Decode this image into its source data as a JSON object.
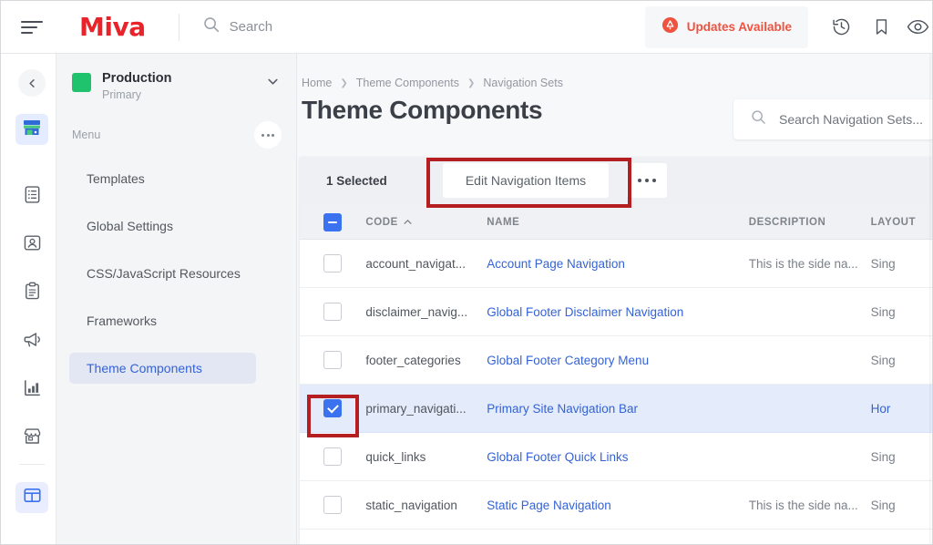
{
  "topbar": {
    "menu_icon": "hamburger-icon",
    "brand": "Miva",
    "search_placeholder": "Search",
    "search_icon": "search-icon",
    "updates_label": "Updates Available",
    "updates_icon": "alert-circle-icon",
    "updates_color": "#ef5340",
    "icons": [
      {
        "name": "history-icon"
      },
      {
        "name": "bookmark-icon"
      },
      {
        "name": "eye-icon"
      }
    ]
  },
  "rail": {
    "collapse_icon": "chevron-left-icon",
    "items": [
      {
        "name": "store-icon",
        "active": true
      },
      {
        "name": "orders-icon",
        "active": false
      },
      {
        "name": "customers-icon",
        "active": false
      },
      {
        "name": "catalog-icon",
        "active": false
      },
      {
        "name": "marketing-icon",
        "active": false
      },
      {
        "name": "reports-icon",
        "active": false
      },
      {
        "name": "storefront-icon",
        "active": false
      },
      {
        "name": "theme-icon",
        "active": true
      }
    ]
  },
  "sidebar": {
    "store_name": "Production",
    "store_sub": "Primary",
    "store_swatch_color": "#1fc26d",
    "chevron_icon": "chevron-down-icon",
    "menu_label": "Menu",
    "menu_more_icon": "ellipsis-icon",
    "items": [
      {
        "label": "Templates",
        "selected": false
      },
      {
        "label": "Global Settings",
        "selected": false
      },
      {
        "label": "CSS/JavaScript Resources",
        "selected": false
      },
      {
        "label": "Frameworks",
        "selected": false
      },
      {
        "label": "Theme Components",
        "selected": true
      }
    ]
  },
  "main": {
    "breadcrumb": [
      "Home",
      "Theme Components",
      "Navigation Sets"
    ],
    "breadcrumb_separator": "❯",
    "page_title": "Theme Components",
    "search": {
      "placeholder": "Search Navigation Sets...",
      "value": "",
      "icon": "search-icon"
    },
    "toolbar": {
      "selected_count": "1 Selected",
      "edit_label": "Edit Navigation Items",
      "more_icon": "ellipsis-icon"
    },
    "table": {
      "header_checkbox_state": "indeterminate",
      "sort_column": "CODE",
      "sort_direction": "asc",
      "sort_icon": "caret-up-icon",
      "columns": [
        "CODE",
        "NAME",
        "DESCRIPTION",
        "LAYOUT"
      ],
      "rows": [
        {
          "checked": false,
          "code": "account_navigat...",
          "name": "Account Page Navigation",
          "description": "This is the side na...",
          "layout": "Sing"
        },
        {
          "checked": false,
          "code": "disclaimer_navig...",
          "name": "Global Footer Disclaimer Navigation",
          "description": "",
          "layout": "Sing"
        },
        {
          "checked": false,
          "code": "footer_categories",
          "name": "Global Footer Category Menu",
          "description": "",
          "layout": "Sing"
        },
        {
          "checked": true,
          "code": "primary_navigati...",
          "name": "Primary Site Navigation Bar",
          "description": "",
          "layout": "Hor"
        },
        {
          "checked": false,
          "code": "quick_links",
          "name": "Global Footer Quick Links",
          "description": "",
          "layout": "Sing"
        },
        {
          "checked": false,
          "code": "static_navigation",
          "name": "Static Page Navigation",
          "description": "This is the side na...",
          "layout": "Sing"
        }
      ]
    }
  },
  "annotations": {
    "highlight_color": "#b51f22",
    "boxes": [
      "edit-navigation-items-button",
      "selected-row-checkbox"
    ]
  }
}
